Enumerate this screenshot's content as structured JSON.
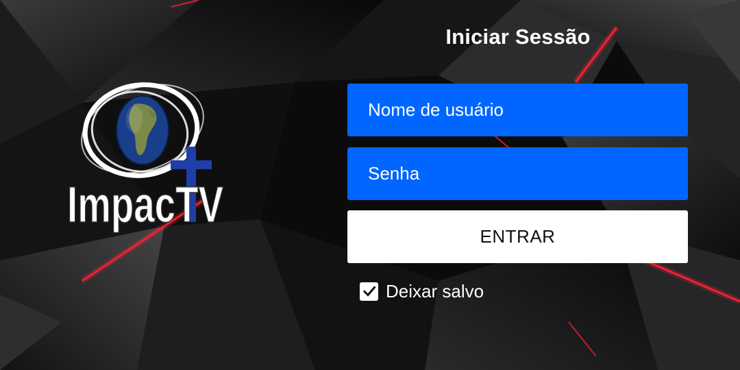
{
  "header": {
    "title": "Iniciar Sessão"
  },
  "form": {
    "username": {
      "placeholder": "Nome de usuário",
      "value": ""
    },
    "password": {
      "placeholder": "Senha",
      "value": ""
    },
    "submit_label": "ENTRAR",
    "remember": {
      "label": "Deixar salvo",
      "checked": true
    }
  },
  "logo": {
    "text": "ImpacTV"
  },
  "icons": {
    "checkbox": "checkmark-icon",
    "logo_globe": "globe-icon",
    "logo_cross": "cross-icon"
  },
  "colors": {
    "field_bg": "#0066ff",
    "button_bg": "#ffffff",
    "accent_red": "#ff2233",
    "background": "#0b0b0c"
  }
}
